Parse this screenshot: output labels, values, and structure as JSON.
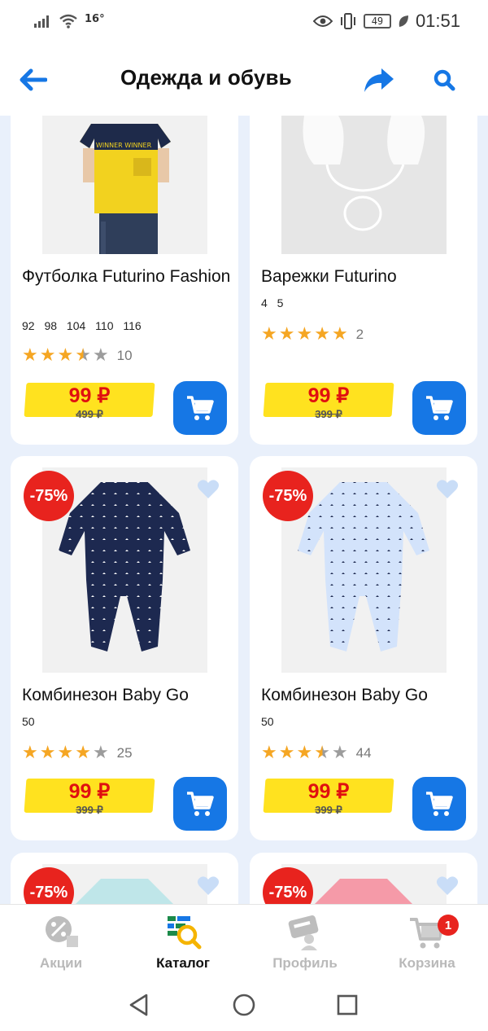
{
  "status_bar": {
    "temperature": "16°",
    "battery": "49",
    "time": "01:51"
  },
  "header": {
    "title": "Одежда и обувь",
    "back_icon": "arrow-left-icon",
    "share_icon": "share-arrow-icon",
    "search_icon": "search-icon"
  },
  "colors": {
    "accent_blue": "#1677e5",
    "price_red": "#e01010",
    "price_tag_yellow": "#ffe21f",
    "discount_red": "#e8231e",
    "star_gold": "#f5a623",
    "background": "#e9f0fb"
  },
  "products": [
    {
      "name": "Футболка Futurino Fashion",
      "sizes": "92 98 104 110 116",
      "rating": 3.5,
      "reviews": "10",
      "price": "99 ₽",
      "old_price": "499 ₽"
    },
    {
      "name": "Варежки Futurino",
      "sizes": "4 5",
      "rating": 5,
      "reviews": "2",
      "price": "99 ₽",
      "old_price": "399 ₽"
    },
    {
      "name": "Комбинезон Baby Go",
      "sizes": "50",
      "rating": 4,
      "reviews": "25",
      "price": "99 ₽",
      "old_price": "399 ₽",
      "discount": "-75%"
    },
    {
      "name": "Комбинезон Baby Go",
      "sizes": "50",
      "rating": 3.5,
      "reviews": "44",
      "price": "99 ₽",
      "old_price": "399 ₽",
      "discount": "-75%"
    },
    {
      "discount": "-75%"
    },
    {
      "discount": "-75%"
    }
  ],
  "bottom_nav": {
    "items": [
      {
        "label": "Акции",
        "icon": "percent-tag-icon"
      },
      {
        "label": "Каталог",
        "icon": "catalog-search-icon",
        "active": true
      },
      {
        "label": "Профиль",
        "icon": "profile-card-icon"
      },
      {
        "label": "Корзина",
        "icon": "cart-icon",
        "badge": "1"
      }
    ]
  },
  "system_nav": {
    "back_icon": "triangle-back-icon",
    "home_icon": "circle-home-icon",
    "recents_icon": "square-recents-icon"
  }
}
